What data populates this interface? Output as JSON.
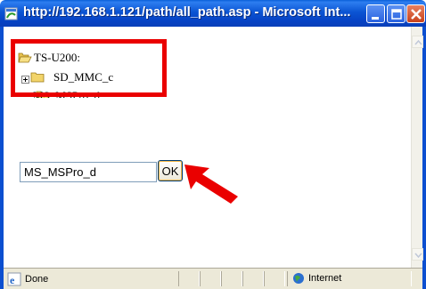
{
  "window": {
    "title": "http://192.168.1.121/path/all_path.asp - Microsoft Int..."
  },
  "tree": {
    "root_label": "TS-U200:",
    "items": [
      {
        "label": "SD_MMC_c",
        "expander": "+"
      },
      {
        "label": "MS_MSPro_d"
      }
    ]
  },
  "form": {
    "path_value": "MS_MSPro_d",
    "ok_label": "OK"
  },
  "annotation": {
    "highlight_color": "#ea0000",
    "arrow_color": "#ea0000"
  },
  "statusbar": {
    "status_text": "Done",
    "zone_text": "Internet"
  },
  "colors": {
    "titlebar": "#0b54d3",
    "folder": "#f2d46a"
  }
}
